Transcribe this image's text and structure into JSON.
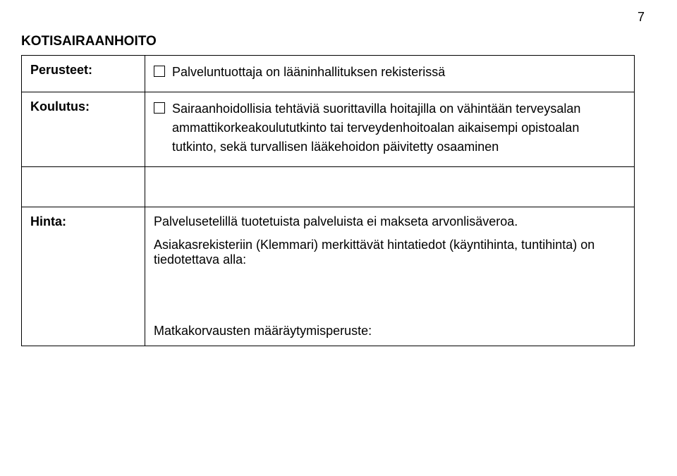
{
  "page_number": "7",
  "heading": "KOTISAIRAANHOITO",
  "rows": {
    "perusteet": {
      "label": "Perusteet:",
      "items": [
        "Palveluntuottaja on lääninhallituksen rekisterissä"
      ]
    },
    "koulutus": {
      "label": "Koulutus:",
      "items": [
        "Sairaanhoidollisia tehtäviä suorittavilla hoitajilla on vähintään terveysalan ammattikorkeakoulututkinto tai terveydenhoitoalan aikaisempi opistoalan tutkinto, sekä turvallisen lääkehoidon päivitetty osaaminen"
      ]
    },
    "hinta": {
      "label": "Hinta:",
      "paragraphs": [
        "Palvelusetelillä tuotetuista palveluista ei makseta arvonlisäveroa.",
        "Asiakasrekisteriin (Klemmari) merkittävät hintatiedot (käyntihinta, tuntihinta) on tiedotettava alla:",
        "Matkakorvausten määräytymisperuste:"
      ]
    }
  }
}
